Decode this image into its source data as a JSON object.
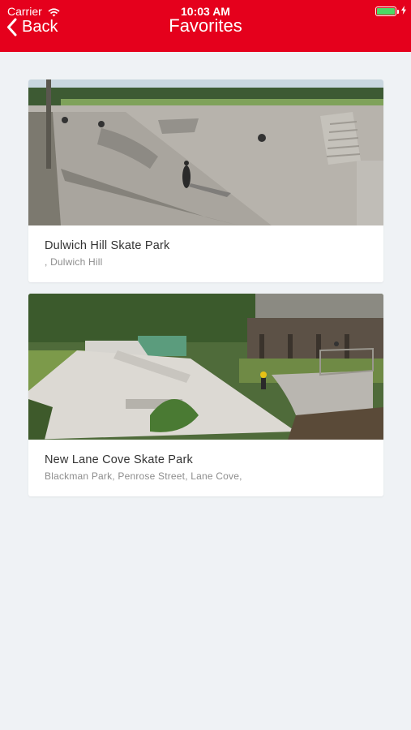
{
  "status_bar": {
    "carrier": "Carrier",
    "time": "10:03 AM",
    "battery_color": "#4cd964"
  },
  "nav": {
    "back_label": "Back",
    "title": "Favorites",
    "background": "#e5001c"
  },
  "favorites": [
    {
      "name": "Dulwich Hill Skate Park",
      "address": ", Dulwich Hill"
    },
    {
      "name": "New Lane Cove Skate Park",
      "address": "Blackman Park, Penrose Street, Lane Cove,"
    }
  ]
}
